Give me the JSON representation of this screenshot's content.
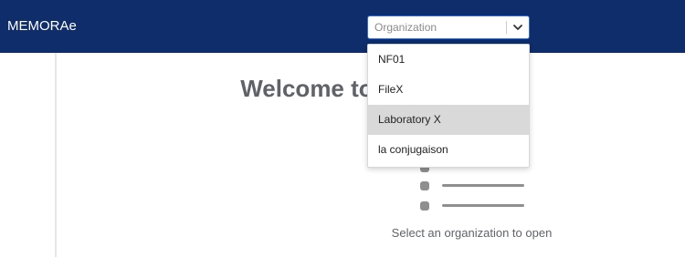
{
  "app": {
    "title": "MEMORAe"
  },
  "org_select": {
    "placeholder": "Organization",
    "value": "",
    "expanded": true,
    "options": [
      "NF01",
      "FileX",
      "Laboratory X",
      "la conjugaison"
    ],
    "highlighted": "Laboratory X"
  },
  "main": {
    "welcome_text": "Welcome to MEMORAe",
    "empty_hint": "Select an organization to open"
  },
  "theme": {
    "topbar_bg": "#0f2d6b",
    "focus_border": "#2f6fd6",
    "highlight_bg": "#d9d9d9"
  }
}
